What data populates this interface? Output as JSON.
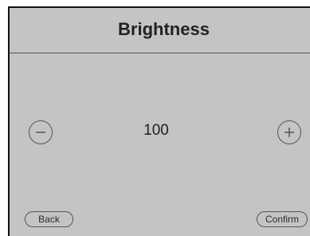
{
  "header": {
    "title": "Brightness"
  },
  "control": {
    "value": "100",
    "decrement_icon": "minus-circle-icon",
    "increment_icon": "plus-circle-icon"
  },
  "footer": {
    "back_label": "Back",
    "confirm_label": "Confirm"
  },
  "colors": {
    "background": "#c4c4c4",
    "text": "#1a1a1a",
    "outline": "#555555"
  }
}
